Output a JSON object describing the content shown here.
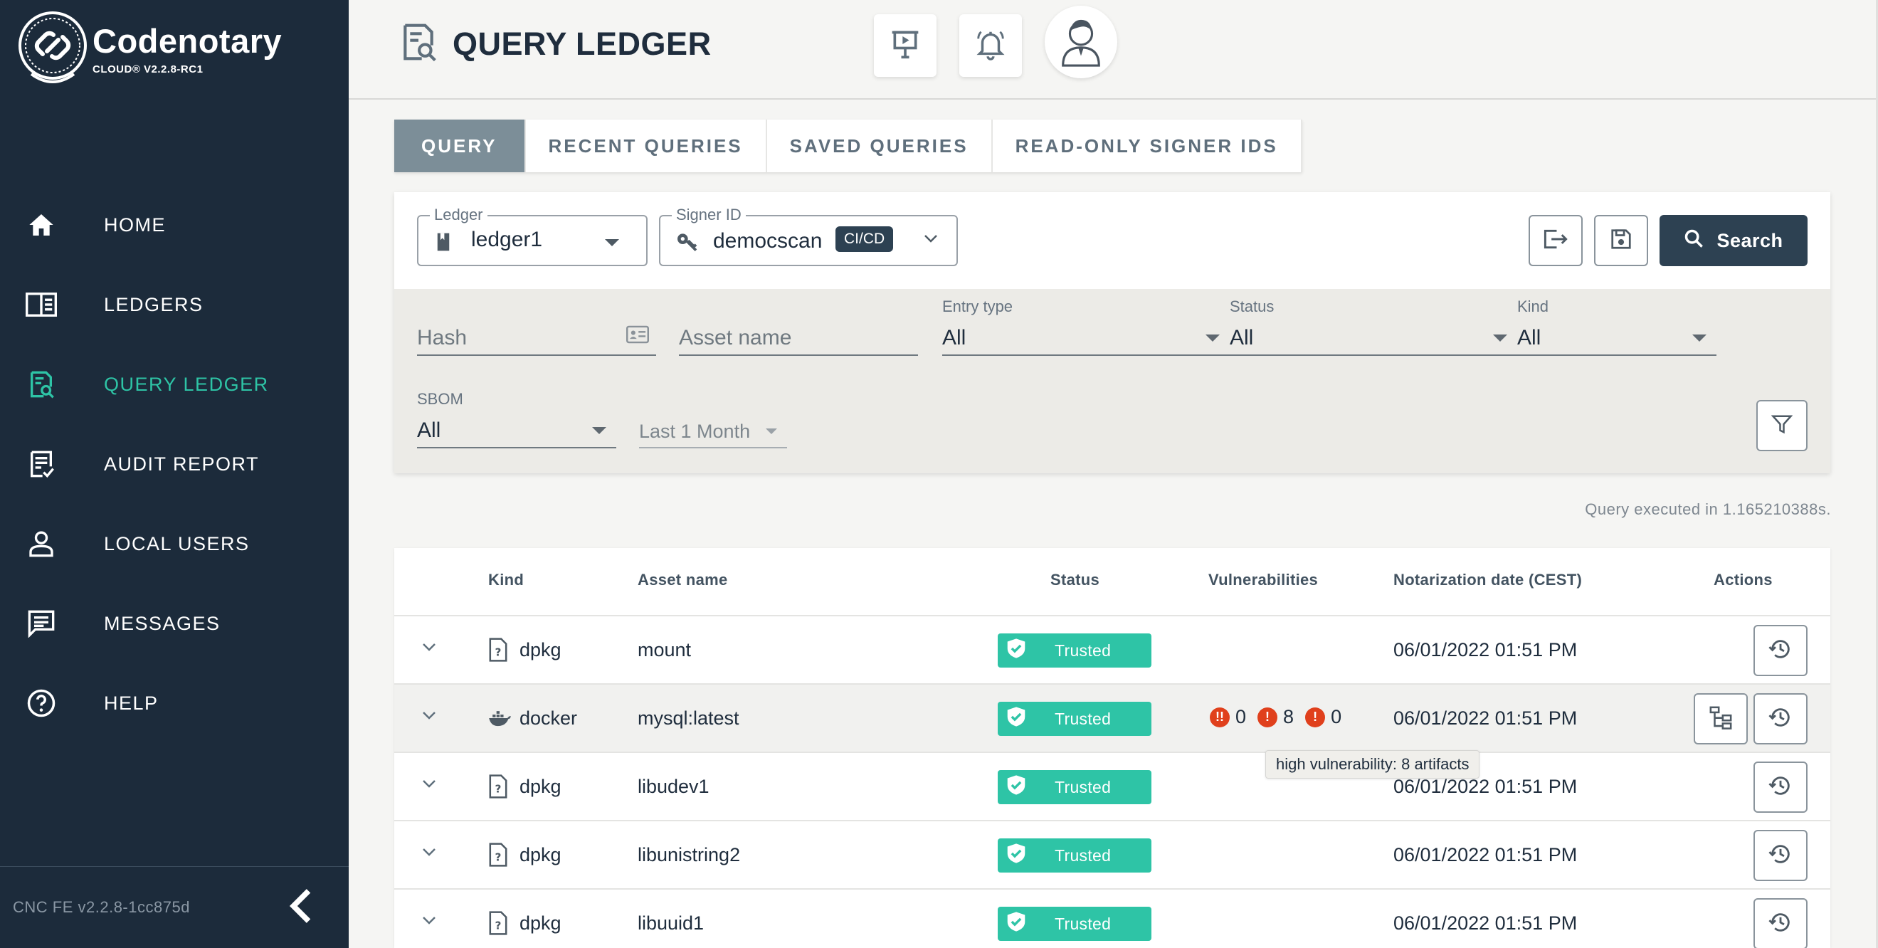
{
  "brand": {
    "name": "Codenotary",
    "version": "CLOUD® V2.2.8-RC1"
  },
  "sidebar": {
    "items": [
      {
        "label": "HOME",
        "icon": "home-icon"
      },
      {
        "label": "LEDGERS",
        "icon": "ledger-book-icon"
      },
      {
        "label": "QUERY LEDGER",
        "icon": "query-document-icon",
        "active": true
      },
      {
        "label": "AUDIT REPORT",
        "icon": "audit-report-icon"
      },
      {
        "label": "LOCAL USERS",
        "icon": "user-icon"
      },
      {
        "label": "MESSAGES",
        "icon": "message-icon"
      },
      {
        "label": "HELP",
        "icon": "help-icon"
      }
    ],
    "footer_version": "CNC FE v2.2.8-1cc875d",
    "collapse_icon": "chevron-left-icon"
  },
  "header": {
    "title": "QUERY LEDGER",
    "buttons": [
      "presentation-icon",
      "bell-icon",
      "avatar"
    ]
  },
  "tabs": [
    {
      "label": "QUERY",
      "active": true
    },
    {
      "label": "RECENT QUERIES"
    },
    {
      "label": "SAVED QUERIES"
    },
    {
      "label": "READ-ONLY SIGNER IDS"
    }
  ],
  "query": {
    "ledger": {
      "label": "Ledger",
      "value": "ledger1"
    },
    "signer": {
      "label": "Signer ID",
      "value": "democscan",
      "chip": "CI/CD"
    },
    "search_label": "Search",
    "hash_placeholder": "Hash",
    "asset_placeholder": "Asset name",
    "entry_type": {
      "label": "Entry type",
      "value": "All"
    },
    "status": {
      "label": "Status",
      "value": "All"
    },
    "kind": {
      "label": "Kind",
      "value": "All"
    },
    "sbom": {
      "label": "SBOM",
      "value": "All"
    },
    "period": "Last 1 Month",
    "exec_time": "Query executed in 1.165210388s."
  },
  "table": {
    "headers": {
      "kind": "Kind",
      "asset": "Asset name",
      "status": "Status",
      "vulns": "Vulnerabilities",
      "date": "Notarization date (CEST)",
      "actions": "Actions"
    },
    "rows": [
      {
        "kind": "dpkg",
        "asset": "mount",
        "status": "Trusted",
        "date": "06/01/2022 01:51 PM"
      },
      {
        "kind": "docker",
        "asset": "mysql:latest",
        "status": "Trusted",
        "date": "06/01/2022 01:51 PM",
        "vulns": {
          "critical": "0",
          "high": "8",
          "medium": "0"
        }
      },
      {
        "kind": "dpkg",
        "asset": "libudev1",
        "status": "Trusted",
        "date": "06/01/2022 01:51 PM"
      },
      {
        "kind": "dpkg",
        "asset": "libunistring2",
        "status": "Trusted",
        "date": "06/01/2022 01:51 PM"
      },
      {
        "kind": "dpkg",
        "asset": "libuuid1",
        "status": "Trusted",
        "date": "06/01/2022 01:51 PM"
      }
    ]
  },
  "tooltip": "high vulnerability: 8 artifacts",
  "colors": {
    "sidebar_bg": "#1c2b3b",
    "accent": "#2ec4a6",
    "primary_button": "#2d4152",
    "vuln_red": "#e0401c"
  }
}
